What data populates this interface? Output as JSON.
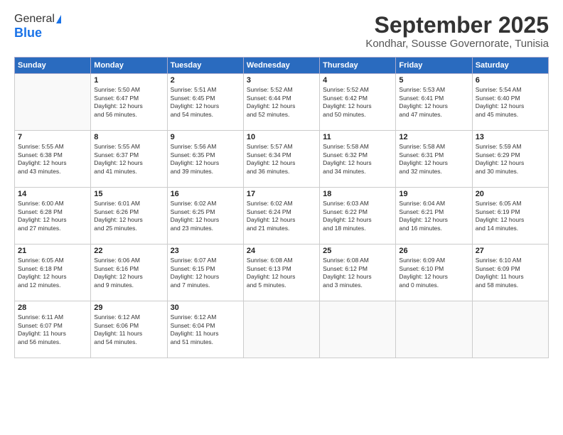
{
  "logo": {
    "line1": "General",
    "line2": "Blue"
  },
  "title": "September 2025",
  "subtitle": "Kondhar, Sousse Governorate, Tunisia",
  "weekdays": [
    "Sunday",
    "Monday",
    "Tuesday",
    "Wednesday",
    "Thursday",
    "Friday",
    "Saturday"
  ],
  "weeks": [
    [
      {
        "day": "",
        "info": ""
      },
      {
        "day": "1",
        "info": "Sunrise: 5:50 AM\nSunset: 6:47 PM\nDaylight: 12 hours\nand 56 minutes."
      },
      {
        "day": "2",
        "info": "Sunrise: 5:51 AM\nSunset: 6:45 PM\nDaylight: 12 hours\nand 54 minutes."
      },
      {
        "day": "3",
        "info": "Sunrise: 5:52 AM\nSunset: 6:44 PM\nDaylight: 12 hours\nand 52 minutes."
      },
      {
        "day": "4",
        "info": "Sunrise: 5:52 AM\nSunset: 6:42 PM\nDaylight: 12 hours\nand 50 minutes."
      },
      {
        "day": "5",
        "info": "Sunrise: 5:53 AM\nSunset: 6:41 PM\nDaylight: 12 hours\nand 47 minutes."
      },
      {
        "day": "6",
        "info": "Sunrise: 5:54 AM\nSunset: 6:40 PM\nDaylight: 12 hours\nand 45 minutes."
      }
    ],
    [
      {
        "day": "7",
        "info": "Sunrise: 5:55 AM\nSunset: 6:38 PM\nDaylight: 12 hours\nand 43 minutes."
      },
      {
        "day": "8",
        "info": "Sunrise: 5:55 AM\nSunset: 6:37 PM\nDaylight: 12 hours\nand 41 minutes."
      },
      {
        "day": "9",
        "info": "Sunrise: 5:56 AM\nSunset: 6:35 PM\nDaylight: 12 hours\nand 39 minutes."
      },
      {
        "day": "10",
        "info": "Sunrise: 5:57 AM\nSunset: 6:34 PM\nDaylight: 12 hours\nand 36 minutes."
      },
      {
        "day": "11",
        "info": "Sunrise: 5:58 AM\nSunset: 6:32 PM\nDaylight: 12 hours\nand 34 minutes."
      },
      {
        "day": "12",
        "info": "Sunrise: 5:58 AM\nSunset: 6:31 PM\nDaylight: 12 hours\nand 32 minutes."
      },
      {
        "day": "13",
        "info": "Sunrise: 5:59 AM\nSunset: 6:29 PM\nDaylight: 12 hours\nand 30 minutes."
      }
    ],
    [
      {
        "day": "14",
        "info": "Sunrise: 6:00 AM\nSunset: 6:28 PM\nDaylight: 12 hours\nand 27 minutes."
      },
      {
        "day": "15",
        "info": "Sunrise: 6:01 AM\nSunset: 6:26 PM\nDaylight: 12 hours\nand 25 minutes."
      },
      {
        "day": "16",
        "info": "Sunrise: 6:02 AM\nSunset: 6:25 PM\nDaylight: 12 hours\nand 23 minutes."
      },
      {
        "day": "17",
        "info": "Sunrise: 6:02 AM\nSunset: 6:24 PM\nDaylight: 12 hours\nand 21 minutes."
      },
      {
        "day": "18",
        "info": "Sunrise: 6:03 AM\nSunset: 6:22 PM\nDaylight: 12 hours\nand 18 minutes."
      },
      {
        "day": "19",
        "info": "Sunrise: 6:04 AM\nSunset: 6:21 PM\nDaylight: 12 hours\nand 16 minutes."
      },
      {
        "day": "20",
        "info": "Sunrise: 6:05 AM\nSunset: 6:19 PM\nDaylight: 12 hours\nand 14 minutes."
      }
    ],
    [
      {
        "day": "21",
        "info": "Sunrise: 6:05 AM\nSunset: 6:18 PM\nDaylight: 12 hours\nand 12 minutes."
      },
      {
        "day": "22",
        "info": "Sunrise: 6:06 AM\nSunset: 6:16 PM\nDaylight: 12 hours\nand 9 minutes."
      },
      {
        "day": "23",
        "info": "Sunrise: 6:07 AM\nSunset: 6:15 PM\nDaylight: 12 hours\nand 7 minutes."
      },
      {
        "day": "24",
        "info": "Sunrise: 6:08 AM\nSunset: 6:13 PM\nDaylight: 12 hours\nand 5 minutes."
      },
      {
        "day": "25",
        "info": "Sunrise: 6:08 AM\nSunset: 6:12 PM\nDaylight: 12 hours\nand 3 minutes."
      },
      {
        "day": "26",
        "info": "Sunrise: 6:09 AM\nSunset: 6:10 PM\nDaylight: 12 hours\nand 0 minutes."
      },
      {
        "day": "27",
        "info": "Sunrise: 6:10 AM\nSunset: 6:09 PM\nDaylight: 11 hours\nand 58 minutes."
      }
    ],
    [
      {
        "day": "28",
        "info": "Sunrise: 6:11 AM\nSunset: 6:07 PM\nDaylight: 11 hours\nand 56 minutes."
      },
      {
        "day": "29",
        "info": "Sunrise: 6:12 AM\nSunset: 6:06 PM\nDaylight: 11 hours\nand 54 minutes."
      },
      {
        "day": "30",
        "info": "Sunrise: 6:12 AM\nSunset: 6:04 PM\nDaylight: 11 hours\nand 51 minutes."
      },
      {
        "day": "",
        "info": ""
      },
      {
        "day": "",
        "info": ""
      },
      {
        "day": "",
        "info": ""
      },
      {
        "day": "",
        "info": ""
      }
    ]
  ]
}
